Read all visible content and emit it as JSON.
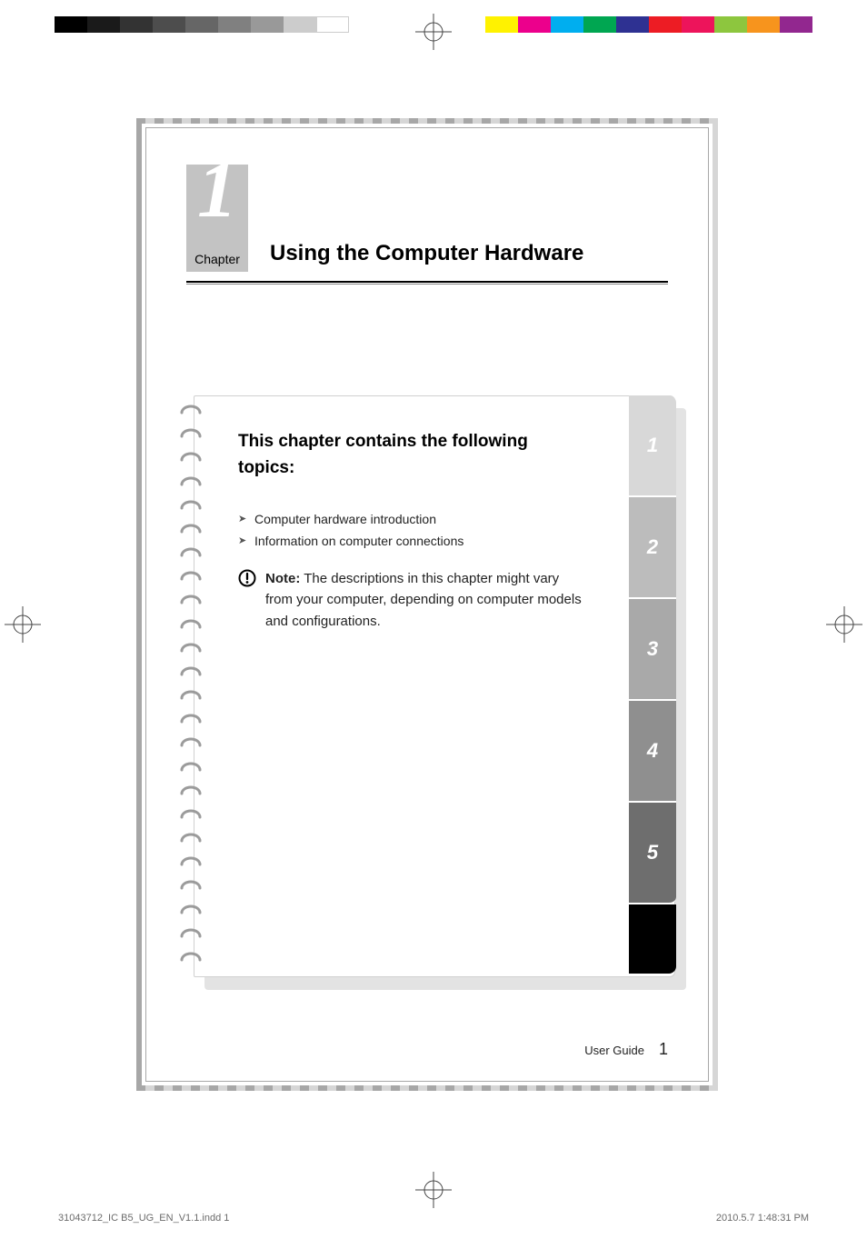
{
  "proof": {
    "gray_swatches": [
      "#000000",
      "#1a1a1a",
      "#333333",
      "#4d4d4d",
      "#666666",
      "#808080",
      "#999999",
      "#cccccc",
      "#ffffff"
    ],
    "color_swatches": [
      "#fff200",
      "#ec008c",
      "#00aeef",
      "#8dc63e",
      "#00a651",
      "#2e3192",
      "#ed1c24",
      "#a6ce39",
      "#f7941d",
      "#92278f"
    ]
  },
  "chapter": {
    "number_glyph": "1",
    "label": "Chapter",
    "title": "Using the Computer Hardware"
  },
  "notebook": {
    "heading": "This chapter contains the following topics:",
    "topics": [
      "Computer hardware introduction",
      "Information on computer connections"
    ],
    "note_label": "Note:",
    "note_body": " The descriptions in this chapter might vary from your computer, depending on computer models and configurations."
  },
  "tabs": [
    "1",
    "2",
    "3",
    "4",
    "5"
  ],
  "footer": {
    "book": "User Guide",
    "page": "1"
  },
  "imposition": {
    "file": "31043712_IC B5_UG_EN_V1.1.indd   1",
    "stamp": "2010.5.7   1:48:31 PM"
  }
}
